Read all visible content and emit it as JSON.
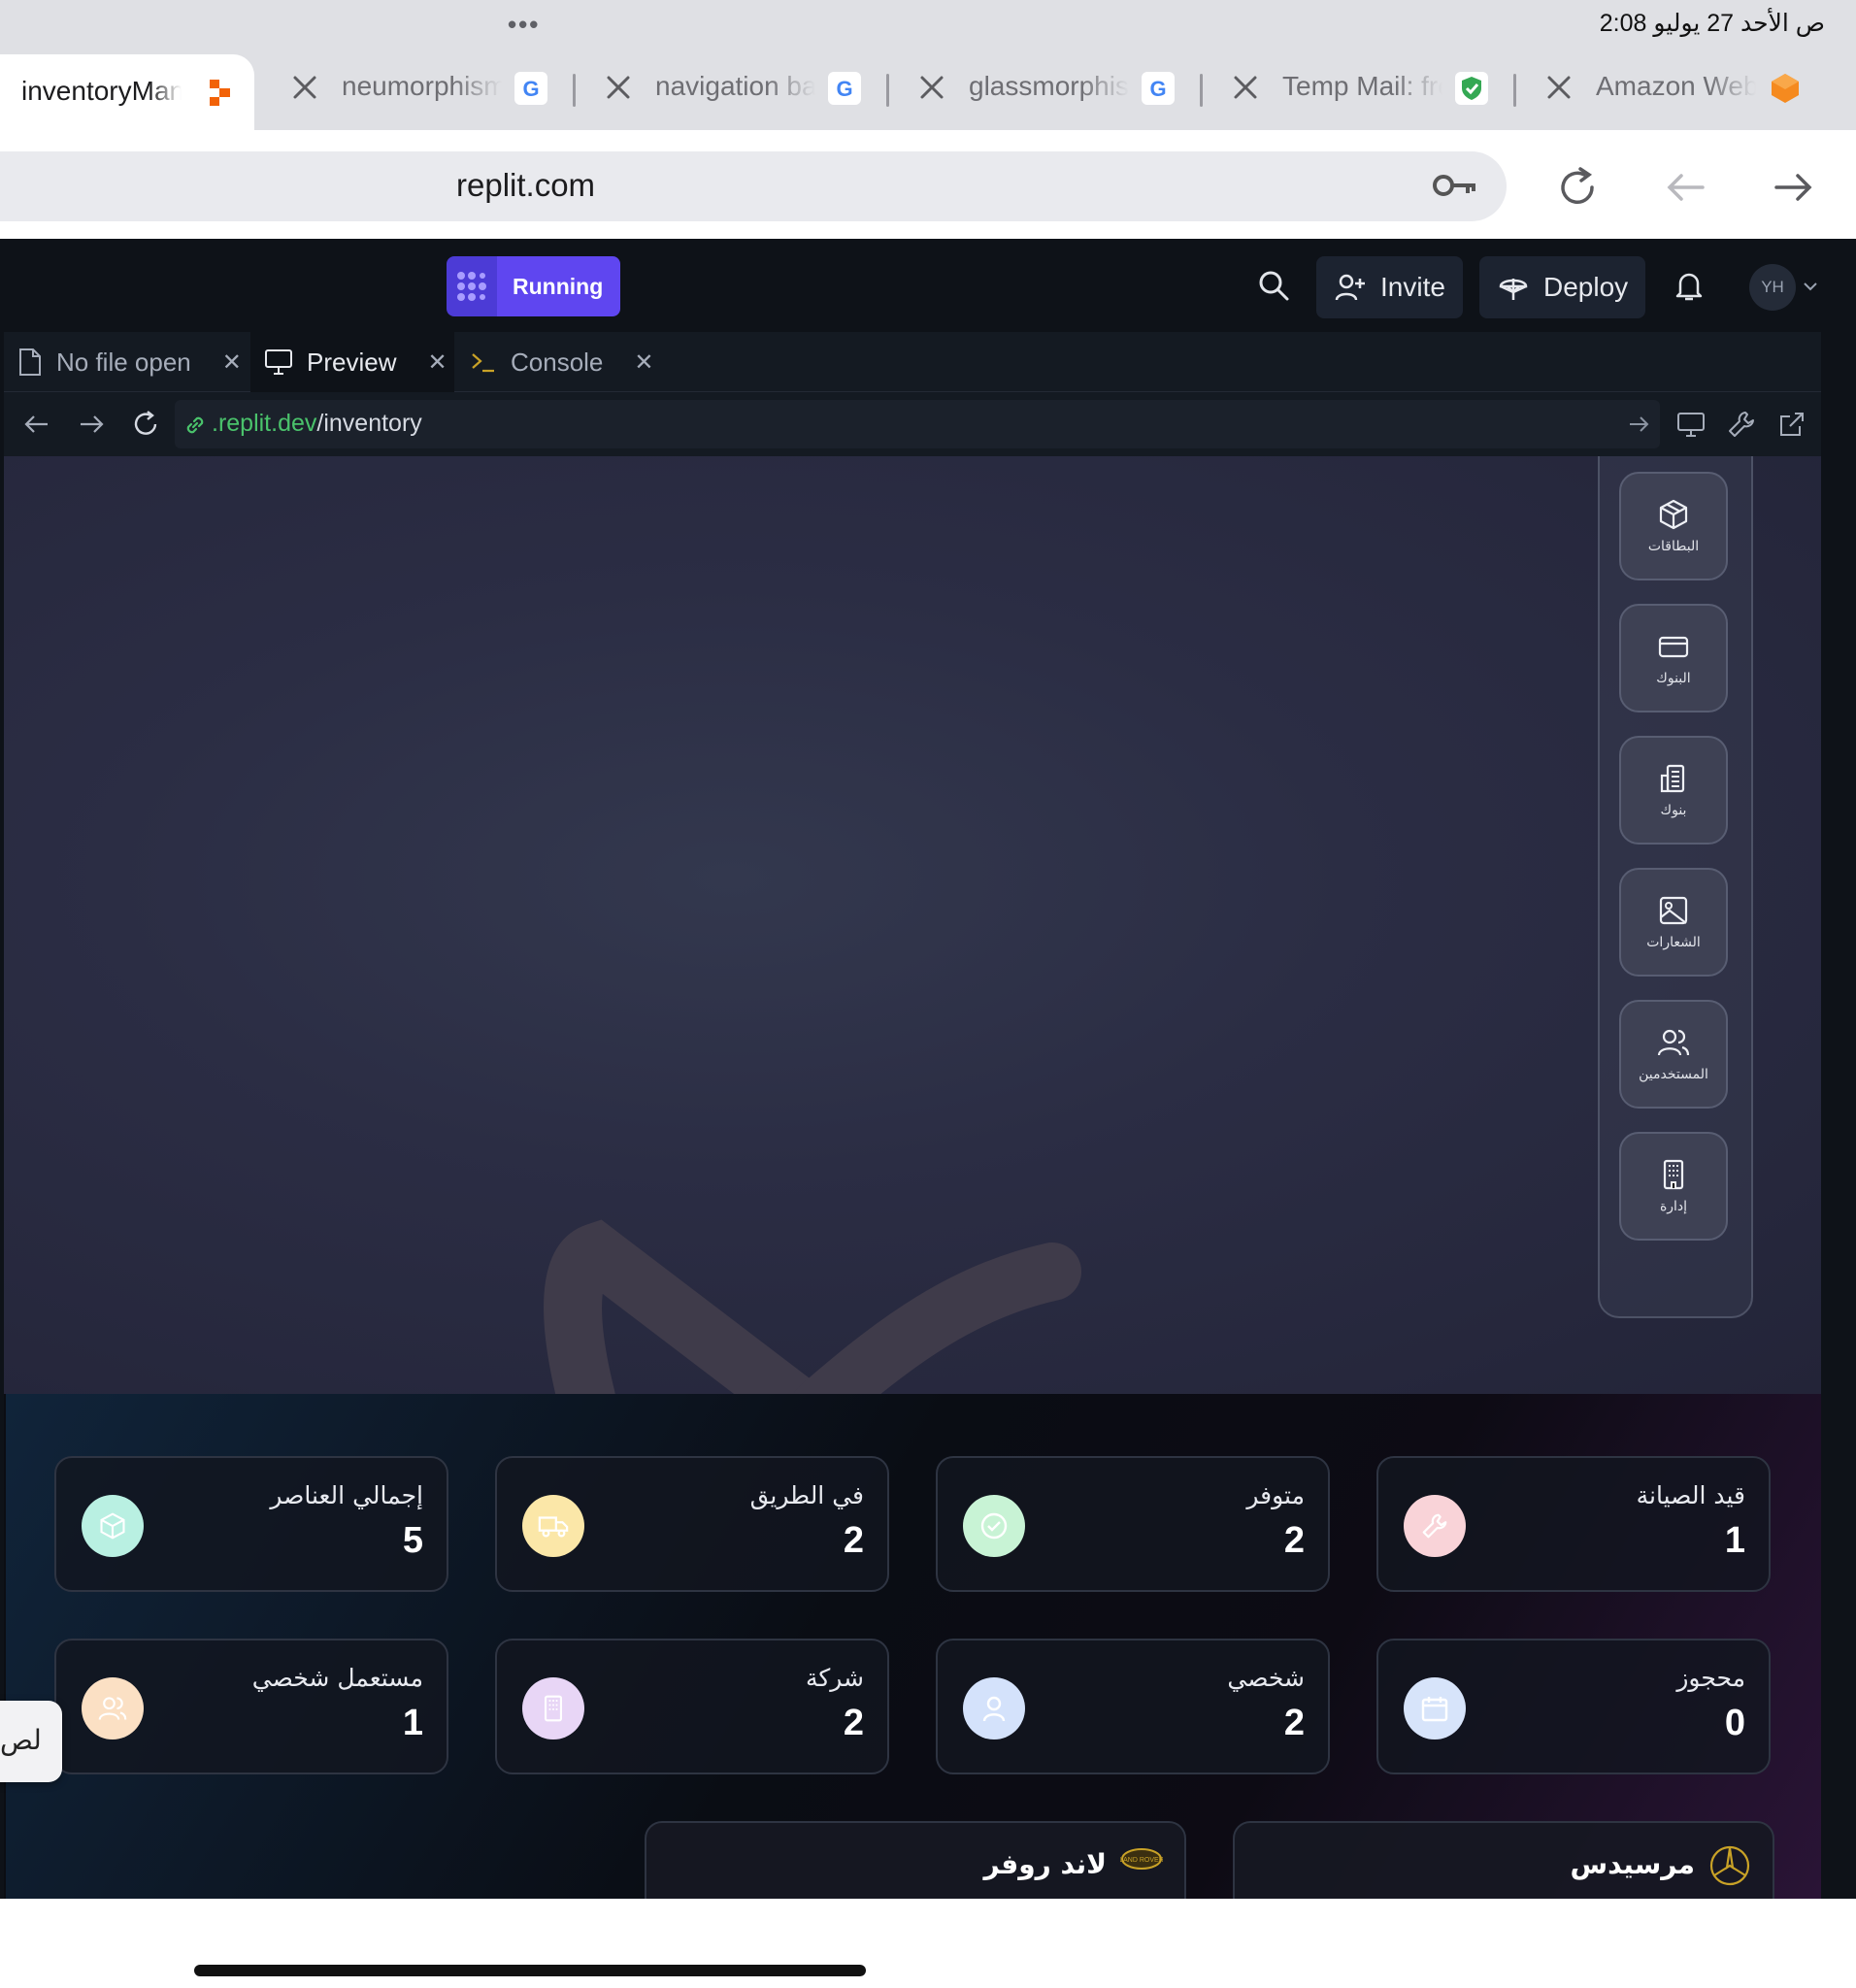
{
  "status_bar": {
    "clock": "2:08 ص  الأحد 27 يوليو",
    "dots": "•••"
  },
  "tabs": [
    {
      "title": "inventoryManager",
      "active": true,
      "favicon": "replit-icon"
    },
    {
      "title": "neumorphism",
      "active": false,
      "favicon": "google-icon"
    },
    {
      "title": "navigation bar",
      "active": false,
      "favicon": "google-icon"
    },
    {
      "title": "glassmorphism",
      "active": false,
      "favicon": "google-icon"
    },
    {
      "title": "Temp Mail: free",
      "active": false,
      "favicon": "shield-icon"
    },
    {
      "title": "Amazon Web",
      "active": false,
      "favicon": "aws-icon"
    }
  ],
  "address_bar": {
    "url": "replit.com"
  },
  "replit": {
    "run_label": "Running",
    "invite_label": "Invite",
    "deploy_label": "Deploy",
    "avatar_initials": "YH",
    "panel_tabs": [
      {
        "label": "No file open"
      },
      {
        "label": "Preview"
      },
      {
        "label": "Console"
      }
    ],
    "preview_url_host": ".replit.dev",
    "preview_url_path": "/inventory"
  },
  "side_nav": [
    {
      "label": "البطاقات",
      "icon": "box-icon"
    },
    {
      "label": "البنوك",
      "icon": "credit-card-icon"
    },
    {
      "label": "بنوك",
      "icon": "building-icon"
    },
    {
      "label": "الشعارات",
      "icon": "image-icon"
    },
    {
      "label": "المستخدمين",
      "icon": "users-icon"
    },
    {
      "label": "إدارة",
      "icon": "office-icon"
    }
  ],
  "stats": [
    {
      "title": "إجمالي العناصر",
      "value": "5",
      "icon": "box-icon",
      "color": "#b9f0e2"
    },
    {
      "title": "في الطريق",
      "value": "2",
      "icon": "truck-icon",
      "color": "#fbe7a8"
    },
    {
      "title": "متوفر",
      "value": "2",
      "icon": "check-circle-icon",
      "color": "#c8f3d5"
    },
    {
      "title": "قيد الصيانة",
      "value": "1",
      "icon": "wrench-icon",
      "color": "#f9d3d8"
    },
    {
      "title": "مستعمل شخصي",
      "value": "1",
      "icon": "users-icon",
      "color": "#fbe0c4"
    },
    {
      "title": "شركة",
      "value": "2",
      "icon": "building-icon",
      "color": "#e8d6f6"
    },
    {
      "title": "شخصي",
      "value": "2",
      "icon": "user-icon",
      "color": "#d4e2fb"
    },
    {
      "title": "محجوز",
      "value": "0",
      "icon": "calendar-icon",
      "color": "#d7e4fa"
    }
  ],
  "brands": [
    {
      "name": "لاند روفر",
      "icon": "land-rover-logo"
    },
    {
      "name": "مرسيدس",
      "icon": "mercedes-logo"
    }
  ],
  "edge_tab_text": "لص"
}
